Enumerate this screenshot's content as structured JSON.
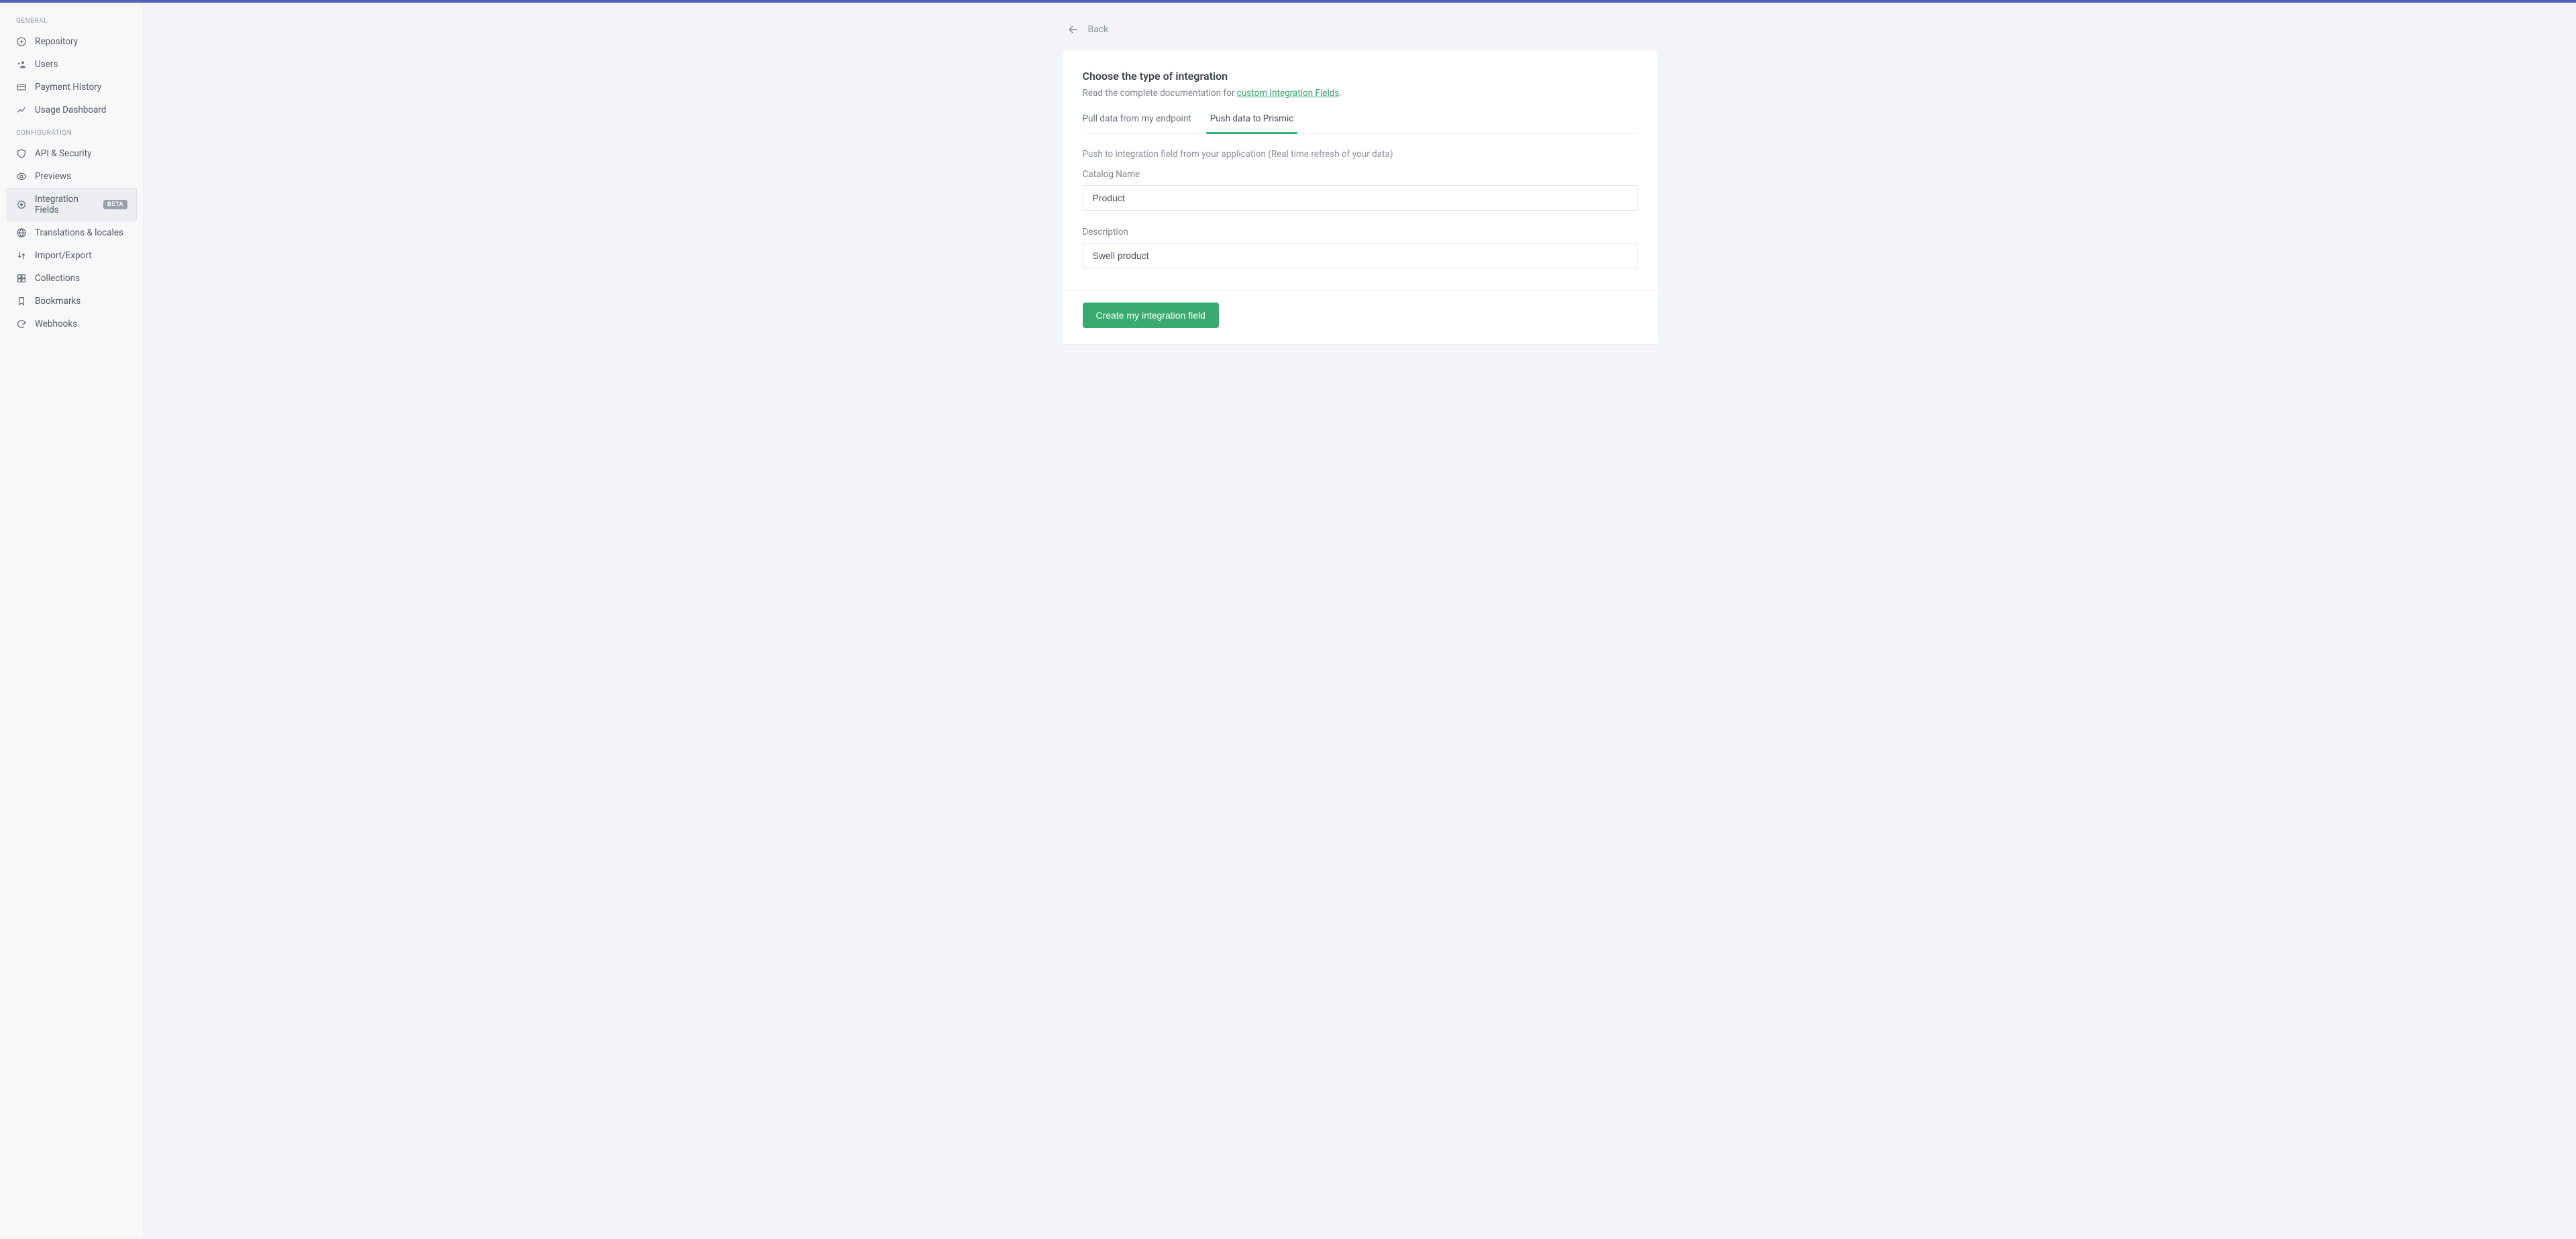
{
  "sidebar": {
    "sections": {
      "general": {
        "label": "GENERAL"
      },
      "configuration": {
        "label": "CONFIGURATION"
      }
    },
    "items": {
      "repository": {
        "label": "Repository"
      },
      "users": {
        "label": "Users"
      },
      "payment_history": {
        "label": "Payment History"
      },
      "usage_dashboard": {
        "label": "Usage Dashboard"
      },
      "api_security": {
        "label": "API & Security"
      },
      "previews": {
        "label": "Previews"
      },
      "integration_fields": {
        "label": "Integration Fields",
        "badge": "BETA"
      },
      "translations_locales": {
        "label": "Translations & locales"
      },
      "import_export": {
        "label": "Import/Export"
      },
      "collections": {
        "label": "Collections"
      },
      "bookmarks": {
        "label": "Bookmarks"
      },
      "webhooks": {
        "label": "Webhooks"
      }
    }
  },
  "back": {
    "label": "Back"
  },
  "panel": {
    "title": "Choose the type of integration",
    "subtext_prefix": "Read the complete documentation for ",
    "subtext_link": "custom Integration Fields",
    "subtext_suffix": ".",
    "tabs": {
      "pull": {
        "label": "Pull data from my endpoint"
      },
      "push": {
        "label": "Push data to Prismic"
      }
    },
    "push": {
      "helper": "Push to integration field from your application (Real time refresh of your data)",
      "catalog_name_label": "Catalog Name",
      "catalog_name_value": "Product",
      "description_label": "Description",
      "description_value": "Swell product"
    },
    "submit_label": "Create my integration field"
  },
  "colors": {
    "accent_top": "#5163ba",
    "primary_button": "#3aab6f",
    "link": "#39a26b"
  }
}
